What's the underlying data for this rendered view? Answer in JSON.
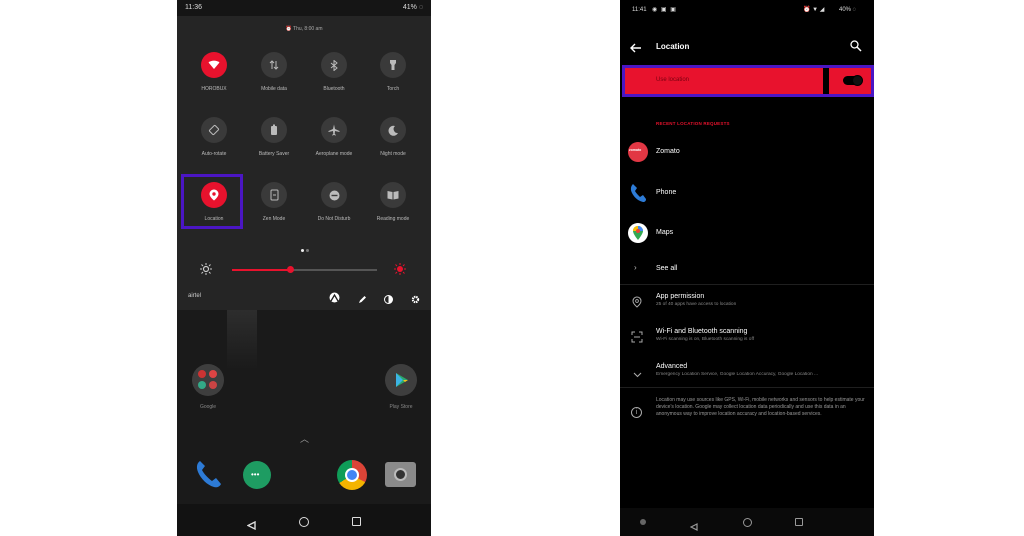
{
  "left": {
    "status": {
      "time": "11:36",
      "battery": "41%"
    },
    "qs_date": "Thu, 8:00 am",
    "tiles": [
      {
        "label": "HOROBUX",
        "icon": "wifi-icon",
        "active": true
      },
      {
        "label": "Mobile data",
        "icon": "mobile-data-icon",
        "active": false
      },
      {
        "label": "Bluetooth",
        "icon": "bluetooth-icon",
        "active": false
      },
      {
        "label": "Torch",
        "icon": "torch-icon",
        "active": false
      },
      {
        "label": "Auto-rotate",
        "icon": "auto-rotate-icon",
        "active": false
      },
      {
        "label": "Battery Saver",
        "icon": "battery-saver-icon",
        "active": false
      },
      {
        "label": "Aeroplane mode",
        "icon": "airplane-icon",
        "active": false
      },
      {
        "label": "Night mode",
        "icon": "night-mode-icon",
        "active": false
      },
      {
        "label": "Location",
        "icon": "location-icon",
        "active": true
      },
      {
        "label": "Zen Mode",
        "icon": "zen-mode-icon",
        "active": false
      },
      {
        "label": "Do Not Disturb",
        "icon": "do-not-disturb-icon",
        "active": false
      },
      {
        "label": "Reading mode",
        "icon": "reading-mode-icon",
        "active": false
      }
    ],
    "brightness": 0.4,
    "carrier": "airtel",
    "apps": {
      "google": "Google",
      "playstore": "Play Store"
    }
  },
  "right": {
    "status": {
      "time": "11:41",
      "battery": "40%"
    },
    "title": "Location",
    "use_location": {
      "label": "Use location",
      "enabled": true
    },
    "recent_header": "RECENT LOCATION REQUESTS",
    "recent": [
      {
        "name": "Zomato",
        "icon": "zomato-icon"
      },
      {
        "name": "Phone",
        "icon": "phone-icon"
      },
      {
        "name": "Maps",
        "icon": "maps-icon"
      }
    ],
    "see_all": "See all",
    "settings": [
      {
        "title": "App permission",
        "sub": "25 of 40 apps have access to location",
        "icon": "location-pin-icon"
      },
      {
        "title": "Wi-Fi and Bluetooth scanning",
        "sub": "Wi-Fi scanning is on, Bluetooth scanning is off",
        "icon": "scan-icon"
      },
      {
        "title": "Advanced",
        "sub": "Emergency Location Service, Google Location Accuracy, Google Location ...",
        "icon": "chevron-down-icon"
      }
    ],
    "footer": "Location may use sources like GPS, Wi-Fi, mobile networks and sensors to help estimate your device's location. Google may collect location data periodically and use this data in an anonymous way to improve location accuracy and location-based services."
  },
  "colors": {
    "accent": "#e8122d",
    "highlight": "#4b16c4"
  }
}
